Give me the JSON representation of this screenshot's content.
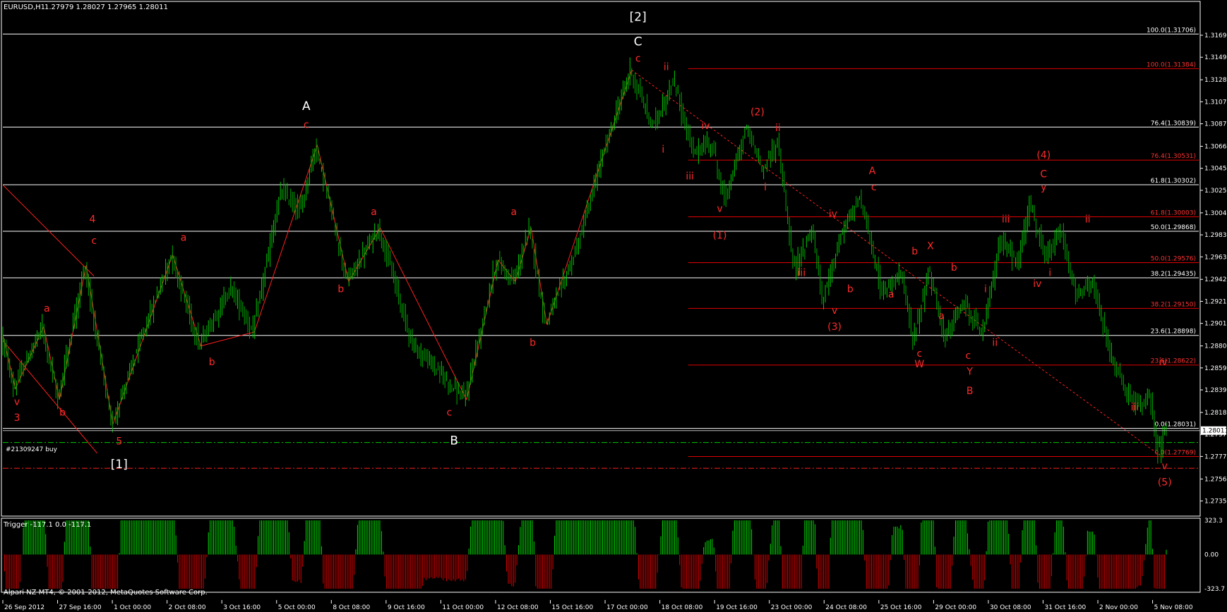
{
  "header": {
    "symbol_tf": "EURUSD,H1",
    "ohlc": "1.27979 1.28027 1.27965 1.28011"
  },
  "footer": {
    "copyright": "Alpari NZ MT4, © 2001-2012, MetaQuotes Software Corp."
  },
  "order": {
    "label": "#21309247 buy",
    "price": 1.279
  },
  "stop_line": {
    "price": 1.2766
  },
  "current_price": {
    "value": 1.28011,
    "label": "1.28011"
  },
  "colors": {
    "up": "#00cc00",
    "down": "#00aa00",
    "wave_white": "#ffffff",
    "wave_red": "#ff2a2a",
    "fib_white": "#ffffff",
    "fib_red": "#e00000",
    "osc_up": "#00dd00",
    "osc_down": "#dd0000"
  },
  "chart_data": [
    {
      "type": "candlestick",
      "title": "EURUSD,H1",
      "ylim": [
        1.2726,
        1.318
      ],
      "yticks": [
        "1.31695",
        "1.31490",
        "1.31280",
        "1.31075",
        "1.30870",
        "1.30660",
        "1.30455",
        "1.30250",
        "1.30040",
        "1.29835",
        "1.29630",
        "1.29420",
        "1.29215",
        "1.29010",
        "1.28800",
        "1.28595",
        "1.28390",
        "1.28180",
        "1.27975",
        "1.27770",
        "1.27560",
        "1.27355"
      ],
      "xticks": [
        "26 Sep 2012",
        "27 Sep 16:00",
        "1 Oct 00:00",
        "2 Oct 08:00",
        "3 Oct 16:00",
        "5 Oct 00:00",
        "8 Oct 08:00",
        "9 Oct 16:00",
        "11 Oct 00:00",
        "12 Oct 08:00",
        "15 Oct 16:00",
        "17 Oct 00:00",
        "18 Oct 08:00",
        "19 Oct 16:00",
        "23 Oct 00:00",
        "24 Oct 08:00",
        "25 Oct 16:00",
        "29 Oct 00:00",
        "30 Oct 08:00",
        "31 Oct 16:00",
        "2 Nov 00:00",
        "5 Nov 08:00"
      ],
      "xtick_index": [
        0,
        32,
        64,
        96,
        128,
        160,
        192,
        224,
        256,
        288,
        320,
        352,
        384,
        416,
        448,
        480,
        512,
        544,
        576,
        608,
        640,
        672
      ],
      "bar_count": 680,
      "path_points": [
        [
          0,
          1.289
        ],
        [
          8,
          1.284
        ],
        [
          26,
          1.2898
        ],
        [
          36,
          1.283
        ],
        [
          53,
          1.2955
        ],
        [
          70,
          1.2807
        ],
        [
          108,
          1.2965
        ],
        [
          126,
          1.288
        ],
        [
          146,
          1.2935
        ],
        [
          160,
          1.2893
        ],
        [
          178,
          1.3025
        ],
        [
          190,
          1.3005
        ],
        [
          200,
          1.3067
        ],
        [
          220,
          1.294
        ],
        [
          240,
          1.299
        ],
        [
          262,
          1.288
        ],
        [
          276,
          1.286
        ],
        [
          295,
          1.283
        ],
        [
          315,
          1.296
        ],
        [
          326,
          1.294
        ],
        [
          336,
          1.299
        ],
        [
          346,
          1.29
        ],
        [
          366,
          1.297
        ],
        [
          384,
          1.3065
        ],
        [
          400,
          1.3137
        ],
        [
          414,
          1.3085
        ],
        [
          428,
          1.3125
        ],
        [
          440,
          1.306
        ],
        [
          452,
          1.307
        ],
        [
          460,
          1.3015
        ],
        [
          474,
          1.3083
        ],
        [
          484,
          1.3045
        ],
        [
          494,
          1.307
        ],
        [
          504,
          1.295
        ],
        [
          516,
          1.299
        ],
        [
          522,
          1.292
        ],
        [
          532,
          1.2975
        ],
        [
          546,
          1.302
        ],
        [
          560,
          1.293
        ],
        [
          572,
          1.295
        ],
        [
          580,
          1.2885
        ],
        [
          590,
          1.295
        ],
        [
          600,
          1.2888
        ],
        [
          612,
          1.292
        ],
        [
          624,
          1.289
        ],
        [
          636,
          1.2982
        ],
        [
          646,
          1.2955
        ],
        [
          654,
          1.3013
        ],
        [
          664,
          1.296
        ],
        [
          674,
          1.2985
        ],
        [
          684,
          1.2925
        ],
        [
          694,
          1.294
        ],
        [
          704,
          1.288
        ],
        [
          714,
          1.284
        ],
        [
          724,
          1.282
        ],
        [
          730,
          1.284
        ],
        [
          736,
          1.2778
        ],
        [
          740,
          1.2801
        ]
      ],
      "fib_white": [
        {
          "label": "100.0(1.31706)",
          "price": 1.31706
        },
        {
          "label": "76.4(1.30839)",
          "price": 1.30839
        },
        {
          "label": "61.8(1.30302)",
          "price": 1.30302
        },
        {
          "label": "50.0(1.29868)",
          "price": 1.29868
        },
        {
          "label": "38.2(1.29435)",
          "price": 1.29435
        },
        {
          "label": "23.6(1.28898)",
          "price": 1.28898
        },
        {
          "label": "0.0(1.28031)",
          "price": 1.28031
        }
      ],
      "fib_red": [
        {
          "label": "100.0(1.31384)",
          "price": 1.31384
        },
        {
          "label": "76.4(1.30531)",
          "price": 1.30531
        },
        {
          "label": "61.8(1.30003)",
          "price": 1.30003
        },
        {
          "label": "50.0(1.29576)",
          "price": 1.29576
        },
        {
          "label": "38.2(1.29150)",
          "price": 1.2915
        },
        {
          "label": "23.6(1.28622)",
          "price": 1.28622
        },
        {
          "label": "0.0(1.27769)",
          "price": 1.27769
        }
      ],
      "wave_labels_white": [
        {
          "text": "[2]",
          "i": 404,
          "price": 1.3183
        },
        {
          "text": "C",
          "i": 404,
          "price": 1.316
        },
        {
          "text": "A",
          "i": 193,
          "price": 1.31
        },
        {
          "text": "B",
          "i": 287,
          "price": 1.2788
        },
        {
          "text": "[1]",
          "i": 74,
          "price": 1.2766
        }
      ],
      "wave_labels_red": [
        {
          "text": "4",
          "i": 57,
          "price": 1.2995
        },
        {
          "text": "c",
          "i": 58,
          "price": 1.2975
        },
        {
          "text": "a",
          "i": 28,
          "price": 1.2912
        },
        {
          "text": "v",
          "i": 9,
          "price": 1.2825
        },
        {
          "text": "3",
          "i": 9,
          "price": 1.281
        },
        {
          "text": "b",
          "i": 38,
          "price": 1.2815
        },
        {
          "text": "5",
          "i": 74,
          "price": 1.2788
        },
        {
          "text": "a",
          "i": 115,
          "price": 1.2978
        },
        {
          "text": "b",
          "i": 133,
          "price": 1.2862
        },
        {
          "text": "c",
          "i": 193,
          "price": 1.3083
        },
        {
          "text": "a",
          "i": 236,
          "price": 1.3002
        },
        {
          "text": "b",
          "i": 215,
          "price": 1.293
        },
        {
          "text": "c",
          "i": 284,
          "price": 1.2815
        },
        {
          "text": "a",
          "i": 325,
          "price": 1.3002
        },
        {
          "text": "b",
          "i": 337,
          "price": 1.288
        },
        {
          "text": "c",
          "i": 404,
          "price": 1.3145
        },
        {
          "text": "ii",
          "i": 422,
          "price": 1.3137
        },
        {
          "text": "i",
          "i": 420,
          "price": 1.306
        },
        {
          "text": "iv",
          "i": 447,
          "price": 1.3082
        },
        {
          "text": "iii",
          "i": 437,
          "price": 1.3035
        },
        {
          "text": "(2)",
          "i": 480,
          "price": 1.3095
        },
        {
          "text": "ii",
          "i": 493,
          "price": 1.308
        },
        {
          "text": "i",
          "i": 485,
          "price": 1.3025
        },
        {
          "text": "v",
          "i": 456,
          "price": 1.3005
        },
        {
          "text": "(1)",
          "i": 456,
          "price": 1.298
        },
        {
          "text": "iv",
          "i": 528,
          "price": 1.3
        },
        {
          "text": "iii",
          "i": 508,
          "price": 1.2945
        },
        {
          "text": "b",
          "i": 539,
          "price": 1.293
        },
        {
          "text": "v",
          "i": 529,
          "price": 1.291
        },
        {
          "text": "(3)",
          "i": 529,
          "price": 1.2895
        },
        {
          "text": "A",
          "i": 553,
          "price": 1.304
        },
        {
          "text": "c",
          "i": 554,
          "price": 1.3025
        },
        {
          "text": "X",
          "i": 590,
          "price": 1.297
        },
        {
          "text": "b",
          "i": 580,
          "price": 1.2965
        },
        {
          "text": "b",
          "i": 605,
          "price": 1.295
        },
        {
          "text": "a",
          "i": 565,
          "price": 1.2925
        },
        {
          "text": "a",
          "i": 597,
          "price": 1.2905
        },
        {
          "text": "c",
          "i": 583,
          "price": 1.287
        },
        {
          "text": "W",
          "i": 583,
          "price": 1.286
        },
        {
          "text": "c",
          "i": 614,
          "price": 1.2868
        },
        {
          "text": "Y",
          "i": 615,
          "price": 1.2853
        },
        {
          "text": "B",
          "i": 615,
          "price": 1.2835
        },
        {
          "text": "i",
          "i": 625,
          "price": 1.293
        },
        {
          "text": "ii",
          "i": 631,
          "price": 1.288
        },
        {
          "text": "iii",
          "i": 638,
          "price": 1.2995
        },
        {
          "text": "(4)",
          "i": 662,
          "price": 1.3055
        },
        {
          "text": "C",
          "i": 662,
          "price": 1.3037
        },
        {
          "text": "y",
          "i": 662,
          "price": 1.3025
        },
        {
          "text": "ii",
          "i": 690,
          "price": 1.2995
        },
        {
          "text": "i",
          "i": 666,
          "price": 1.2945
        },
        {
          "text": "iv",
          "i": 658,
          "price": 1.2935
        },
        {
          "text": "iv",
          "i": 738,
          "price": 1.2862
        },
        {
          "text": "iii",
          "i": 720,
          "price": 1.282
        },
        {
          "text": "v",
          "i": 739,
          "price": 1.2765
        },
        {
          "text": "(5)",
          "i": 739,
          "price": 1.275
        }
      ]
    },
    {
      "type": "histogram",
      "title": "Trigger -117.1 0.0 -117.1",
      "ylim": [
        -323.7,
        323.3
      ],
      "yticks": [
        "323.3",
        "0.00",
        "-323.7"
      ]
    }
  ]
}
